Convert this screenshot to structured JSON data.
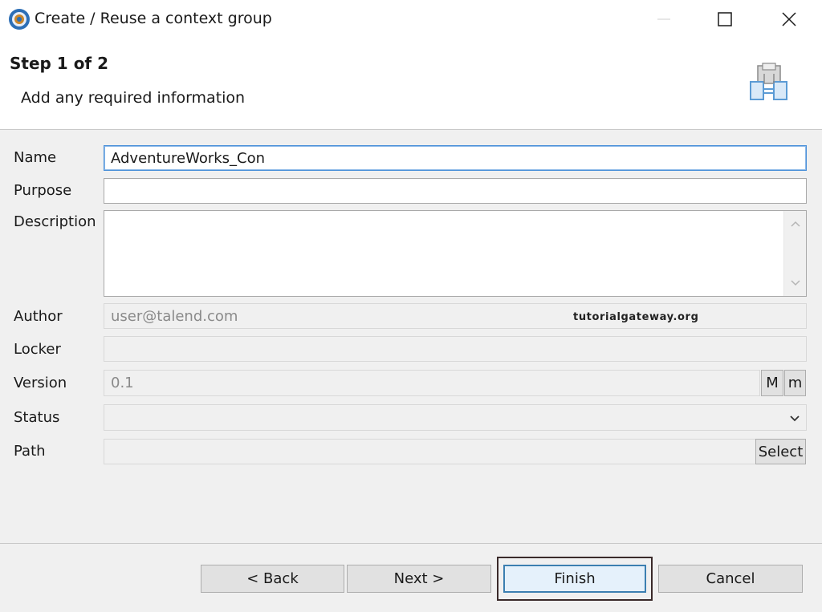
{
  "window": {
    "title": "Create / Reuse a context group",
    "icon": "talend-app-icon"
  },
  "header": {
    "step": "Step 1 of 2",
    "description": "Add any required information",
    "icon": "context-group-wizard-icon"
  },
  "form": {
    "name": {
      "label": "Name",
      "value": "AdventureWorks_Con"
    },
    "purpose": {
      "label": "Purpose",
      "value": ""
    },
    "description": {
      "label": "Description",
      "value": ""
    },
    "author": {
      "label": "Author",
      "value": "user@talend.com"
    },
    "locker": {
      "label": "Locker",
      "value": ""
    },
    "version": {
      "label": "Version",
      "value": "0.1",
      "major_btn": "M",
      "minor_btn": "m"
    },
    "status": {
      "label": "Status",
      "value": ""
    },
    "path": {
      "label": "Path",
      "value": "",
      "select_btn": "Select"
    }
  },
  "watermark": "tutorialgateway.org",
  "footer": {
    "back": "< Back",
    "next": "Next >",
    "finish": "Finish",
    "cancel": "Cancel"
  },
  "colors": {
    "focus_border": "#4a90d9",
    "default_button_border": "#3c7fb1",
    "dialog_bg": "#f0f0f0"
  }
}
